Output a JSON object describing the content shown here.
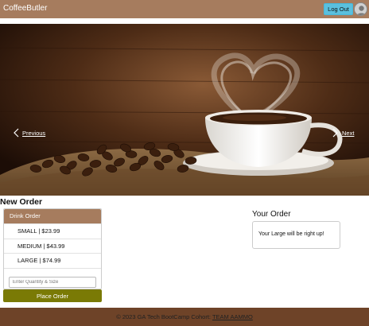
{
  "navbar": {
    "brand": "CoffeeButler",
    "logout_label": "Log Out"
  },
  "carousel": {
    "prev_label": "Previous",
    "next_label": "Next"
  },
  "new_order": {
    "title": "New Order",
    "header": "Drink Order",
    "items": [
      {
        "label": "SMALL | $23.99"
      },
      {
        "label": "MEDIUM | $43.99"
      },
      {
        "label": "LARGE | $74.99"
      }
    ],
    "quantity_placeholder": "Enter Quantity & Size",
    "place_order_label": "Place Order"
  },
  "your_order": {
    "title": "Your Order",
    "message": "Your Large will be right up!"
  },
  "footer": {
    "text": "© 2023 GA Tech BootCamp Cohort: ",
    "link_label": "TEAM AAMMO"
  },
  "colors": {
    "navbar": "#a67c5e",
    "footer": "#6e4328",
    "logout": "#5bc0de",
    "place_order": "#7a7a05"
  }
}
